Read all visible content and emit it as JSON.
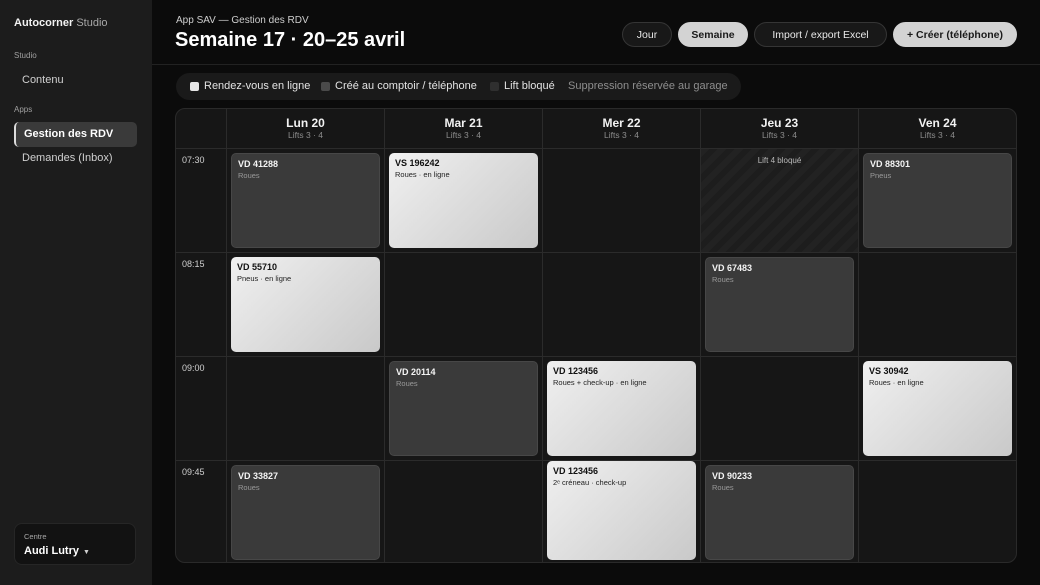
{
  "sidebar": {
    "brand_bold": "Autocorner",
    "brand_light": " Studio",
    "section_studio": "Studio",
    "item_contenu": "Contenu",
    "section_apps": "Apps",
    "item_rdv": "Gestion des RDV",
    "item_demandes": "Demandes (Inbox)",
    "center_label": "Centre",
    "center_value": "Audi Lutry"
  },
  "header": {
    "breadcrumb": "App SAV — Gestion des RDV",
    "title": "Semaine 17 · 20–25 avril",
    "btn_jour": "Jour",
    "btn_semaine": "Semaine",
    "btn_import": "Import / export Excel",
    "btn_create": "+ Créer (téléphone)"
  },
  "legend": {
    "online": "Rendez-vous en ligne",
    "counter": "Créé au comptoir / téléphone",
    "blocked": "Lift bloqué",
    "note": "Suppression réservée au garage"
  },
  "colors": {
    "online": "#e6e6e6",
    "counter": "#4a4a4a",
    "blocked": "#2f2f2f"
  },
  "days": [
    {
      "name": "Lun 20",
      "sub": "Lifts 3 · 4"
    },
    {
      "name": "Mar 21",
      "sub": "Lifts 3 · 4"
    },
    {
      "name": "Mer 22",
      "sub": "Lifts 3 · 4"
    },
    {
      "name": "Jeu 23",
      "sub": "Lifts 3 · 4"
    },
    {
      "name": "Ven 24",
      "sub": "Lifts 3 · 4"
    }
  ],
  "times": [
    "07:30",
    "08:15",
    "09:00",
    "09:45"
  ],
  "blocked_label": "Lift 4 bloqué",
  "appointments": [
    {
      "id": "a1",
      "code": "VD 41288",
      "desc": "Roues"
    },
    {
      "id": "a2",
      "code": "VS 196242",
      "desc": "Roues · en ligne"
    },
    {
      "id": "a3",
      "code": "VD 88301",
      "desc": "Pneus"
    },
    {
      "id": "a4",
      "code": "VD 55710",
      "desc": "Pneus · en ligne"
    },
    {
      "id": "a5",
      "code": "VD 67483",
      "desc": "Roues"
    },
    {
      "id": "a6",
      "code": "VD 20114",
      "desc": "Roues"
    },
    {
      "id": "a7",
      "code": "VD 123456",
      "desc": "Roues + check-up · en ligne"
    },
    {
      "id": "a8",
      "code": "VS 30942",
      "desc": "Roues · en ligne"
    },
    {
      "id": "a9",
      "code": "VD 33827",
      "desc": "Roues"
    },
    {
      "id": "a10",
      "code": "VD 123456",
      "desc": "2ᵉ créneau · check-up"
    },
    {
      "id": "a11",
      "code": "VD 90233",
      "desc": "Roues"
    }
  ]
}
